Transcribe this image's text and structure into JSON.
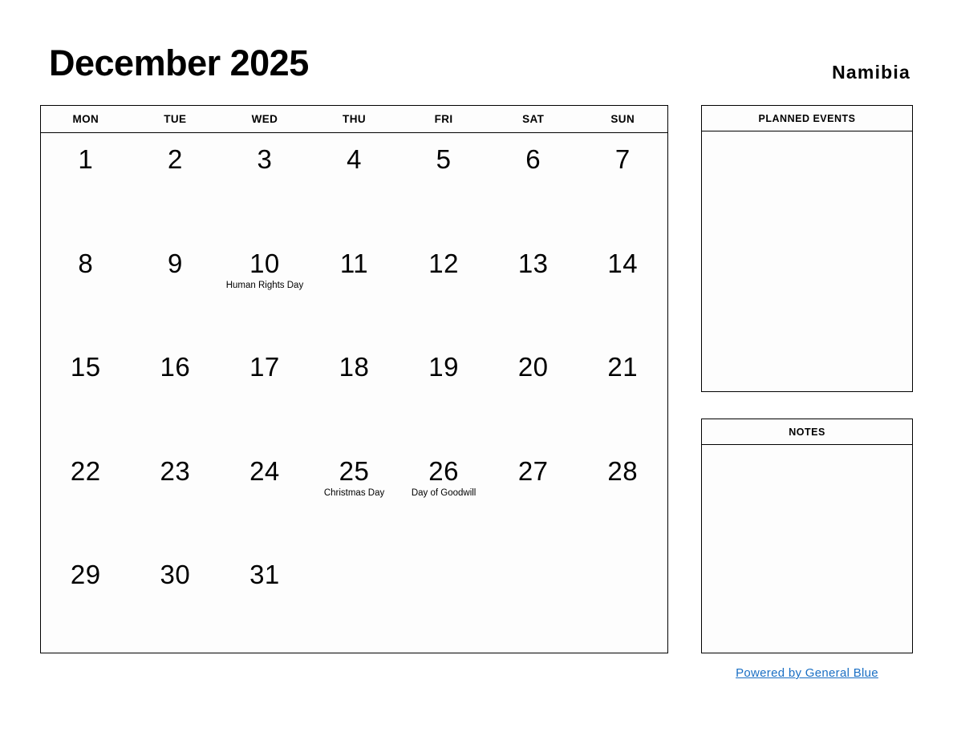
{
  "header": {
    "title": "December 2025",
    "country": "Namibia"
  },
  "calendar": {
    "weekdays": [
      "MON",
      "TUE",
      "WED",
      "THU",
      "FRI",
      "SAT",
      "SUN"
    ],
    "weeks": [
      [
        {
          "day": "1",
          "events": []
        },
        {
          "day": "2",
          "events": []
        },
        {
          "day": "3",
          "events": []
        },
        {
          "day": "4",
          "events": []
        },
        {
          "day": "5",
          "events": []
        },
        {
          "day": "6",
          "events": []
        },
        {
          "day": "7",
          "events": []
        }
      ],
      [
        {
          "day": "8",
          "events": []
        },
        {
          "day": "9",
          "events": []
        },
        {
          "day": "10",
          "events": [
            "Human Rights Day"
          ]
        },
        {
          "day": "11",
          "events": []
        },
        {
          "day": "12",
          "events": []
        },
        {
          "day": "13",
          "events": []
        },
        {
          "day": "14",
          "events": []
        }
      ],
      [
        {
          "day": "15",
          "events": []
        },
        {
          "day": "16",
          "events": []
        },
        {
          "day": "17",
          "events": []
        },
        {
          "day": "18",
          "events": []
        },
        {
          "day": "19",
          "events": []
        },
        {
          "day": "20",
          "events": []
        },
        {
          "day": "21",
          "events": []
        }
      ],
      [
        {
          "day": "22",
          "events": []
        },
        {
          "day": "23",
          "events": []
        },
        {
          "day": "24",
          "events": []
        },
        {
          "day": "25",
          "events": [
            "Christmas Day"
          ]
        },
        {
          "day": "26",
          "events": [
            "Day of Goodwill"
          ]
        },
        {
          "day": "27",
          "events": []
        },
        {
          "day": "28",
          "events": []
        }
      ],
      [
        {
          "day": "29",
          "events": []
        },
        {
          "day": "30",
          "events": []
        },
        {
          "day": "31",
          "events": []
        },
        {
          "day": "",
          "events": []
        },
        {
          "day": "",
          "events": []
        },
        {
          "day": "",
          "events": []
        },
        {
          "day": "",
          "events": []
        }
      ]
    ]
  },
  "panels": {
    "planned_events": {
      "title": "PLANNED EVENTS",
      "content": ""
    },
    "notes": {
      "title": "NOTES",
      "content": ""
    }
  },
  "footer": {
    "link_label": "Powered by General Blue",
    "link_color": "#1a6fc4"
  }
}
